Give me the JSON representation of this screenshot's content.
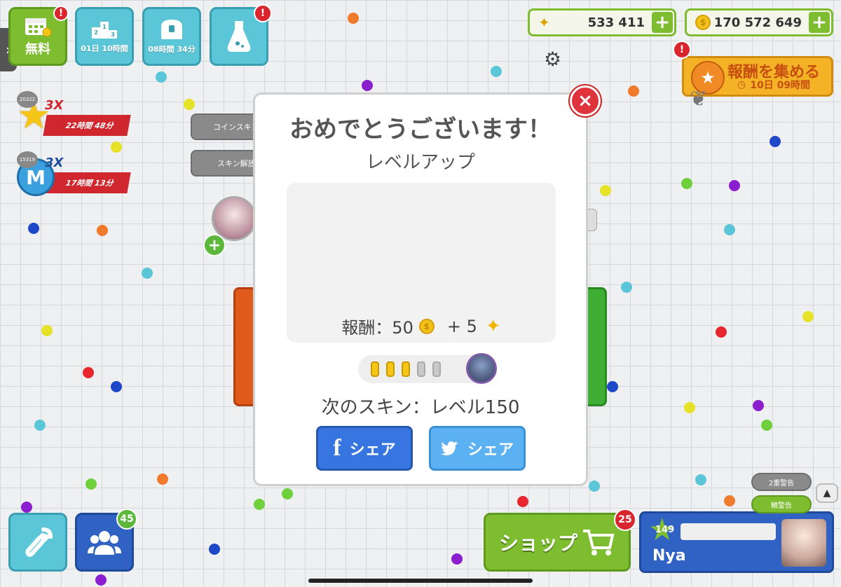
{
  "top_tiles": {
    "free": {
      "label": "無料",
      "icon": "calendar-gift-icon",
      "alert": "!"
    },
    "ranking": {
      "label": "01日 10時間",
      "icon": "podium-icon"
    },
    "chest": {
      "label": "08時間 34分",
      "icon": "treasure-chest-icon"
    },
    "lab": {
      "icon": "potion-flask-icon",
      "alert": "!"
    }
  },
  "currency": {
    "dna": {
      "value": "533 411",
      "icon": "dna-icon",
      "plus": "+"
    },
    "coins": {
      "value": "170 572 649",
      "icon": "coin-icon",
      "plus": "+"
    }
  },
  "settings": {
    "icon": "gear-icon"
  },
  "collect_reward": {
    "label": "報酬を集める",
    "timer": "10日 09時間",
    "alert": "!"
  },
  "boosts": [
    {
      "count": "20322",
      "multiplier": "3X",
      "timer": "22時間 48分",
      "icon": "xp-star-icon"
    },
    {
      "count": "15319",
      "multiplier": "3X",
      "timer": "17時間 13分",
      "icon": "mass-m-icon",
      "letter": "M"
    }
  ],
  "side_buttons": {
    "coin_skin": "コインスキン",
    "skin_unlock": "スキン解放"
  },
  "dialog": {
    "title": "おめでとうございます！",
    "subtitle": "レベルアップ",
    "reward_label": "報酬：50",
    "reward_plus": "+ 5",
    "progress": {
      "filled": 3,
      "total": 5
    },
    "next_skin": "次のスキン：レベル150",
    "share_facebook": "シェア",
    "share_twitter": "シェア",
    "close": "×"
  },
  "bottom": {
    "tools": {
      "icon": "wrench-icon"
    },
    "friends": {
      "icon": "friends-icon",
      "badge": "45"
    },
    "shop": {
      "label": "ショップ",
      "badge": "25",
      "icon": "cart-icon"
    },
    "profile": {
      "level": "149",
      "name": "Nya"
    },
    "warn1": "2重警告",
    "warn2": "鯖警告"
  },
  "colors": {
    "green": "#7dbd2f",
    "red": "#d9262e",
    "cyan": "#5bc6d8",
    "blue": "#2f62c3",
    "gold": "#f5c518"
  }
}
